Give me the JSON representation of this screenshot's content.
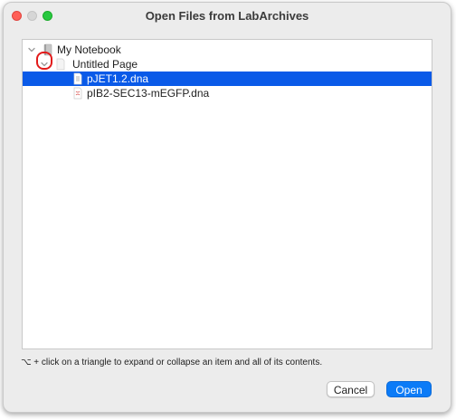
{
  "window": {
    "title": "Open Files from LabArchives"
  },
  "tree": {
    "items": [
      {
        "label": "My Notebook",
        "icon": "notebook-icon",
        "expanded": true
      },
      {
        "label": "Untitled Page",
        "icon": "page-icon",
        "expanded": true
      },
      {
        "label": "pJET1.2.dna",
        "icon": "dna-file-icon",
        "selected": true
      },
      {
        "label": "pIB2-SEC13-mEGFP.dna",
        "icon": "dna-file-icon",
        "selected": false
      }
    ]
  },
  "hint": {
    "text": "⌥ + click on a triangle to expand or collapse an item and all of its contents."
  },
  "buttons": {
    "cancel_label": "Cancel",
    "open_label": "Open"
  },
  "colors": {
    "selection": "#0a5ae8",
    "primary_button": "#0b7bf7",
    "annotation_ring": "#e21b1b"
  }
}
